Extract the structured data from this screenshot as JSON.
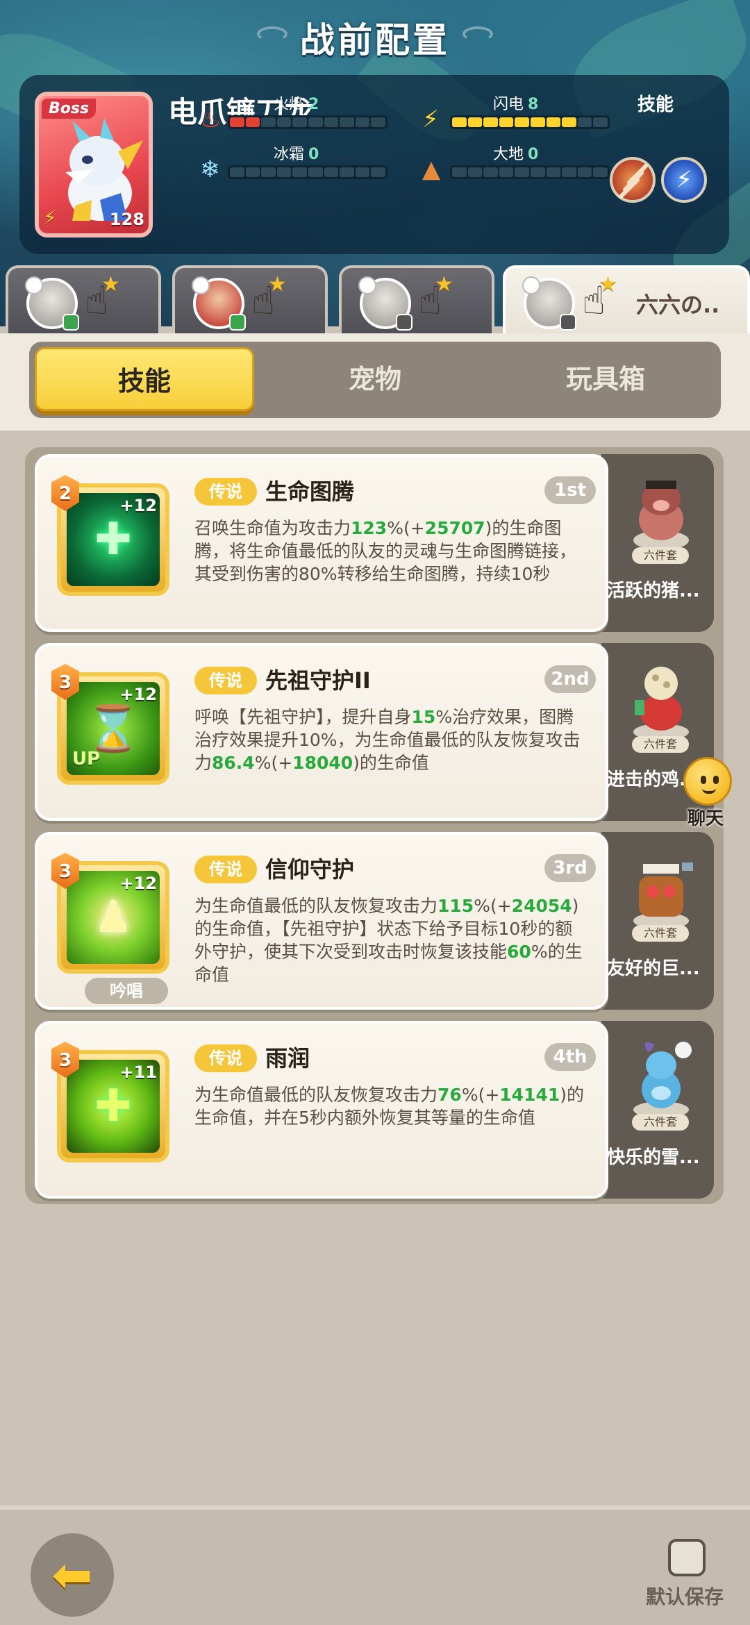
{
  "header": {
    "title": "战前配置"
  },
  "boss": {
    "badge": "Boss",
    "name": "电爪镰刀龙",
    "level": "128",
    "skills_label": "技能",
    "stats": {
      "fire": {
        "label": "火焰",
        "value": "2"
      },
      "lightning": {
        "label": "闪电",
        "value": "8"
      },
      "frost": {
        "label": "冰霜",
        "value": "0"
      },
      "earth": {
        "label": "大地",
        "value": "0"
      }
    }
  },
  "team_tabs": {
    "active_nickname": "六六の.."
  },
  "tabs": {
    "skills": "技能",
    "pets": "宠物",
    "toybox": "玩具箱"
  },
  "skills": [
    {
      "level": "2",
      "plus": "+12",
      "rarity": "传说",
      "name": "生命图腾",
      "order": "1st",
      "desc_parts": [
        "召唤生命值为攻击力",
        "123",
        "%(+",
        "25707",
        ")的生命图腾，将生命值最低的队友的灵魂与生命图腾链接，其受到伤害的80%转移给生命图腾，持续10秒"
      ],
      "pet_name": "活跃的猪...",
      "pet_set": "六件套"
    },
    {
      "level": "3",
      "plus": "+12",
      "rarity": "传说",
      "name": "先祖守护II",
      "order": "2nd",
      "up": "UP",
      "desc_parts": [
        "呼唤【先祖守护】，提升自身",
        "15",
        "%治疗效果，图腾治疗效果提升10%，为生命值最低的队友恢复攻击力",
        "86.4",
        "%(+",
        "18040",
        ")的生命值"
      ],
      "pet_name": "进击的鸡...",
      "pet_set": "六件套"
    },
    {
      "level": "3",
      "plus": "+12",
      "rarity": "传说",
      "name": "信仰守护",
      "order": "3rd",
      "chant": "吟唱",
      "desc_parts": [
        "为生命值最低的队友恢复攻击力",
        "115",
        "%(+",
        "24054",
        ")的生命值，【先祖守护】状态下给予目标10秒的额外守护，使其下次受到攻击时恢复该技能",
        "60",
        "%的生命值"
      ],
      "pet_name": "友好的巨...",
      "pet_set": "六件套"
    },
    {
      "level": "3",
      "plus": "+11",
      "rarity": "传说",
      "name": "雨润",
      "order": "4th",
      "desc_parts": [
        "为生命值最低的队友恢复攻击力",
        "76",
        "%(+",
        "14141",
        ")的生命值，并在5秒内额外恢复其等量的生命值"
      ],
      "pet_name": "快乐的雪...",
      "pet_set": "六件套"
    }
  ],
  "chat": {
    "label": "聊天"
  },
  "footer": {
    "default_save": "默认保存"
  },
  "colors": {
    "accent_yellow": "#f8cf3a",
    "highlight_green": "#27a93b",
    "fire_bar": "#e34132",
    "bolt_bar": "#ffd42c"
  }
}
